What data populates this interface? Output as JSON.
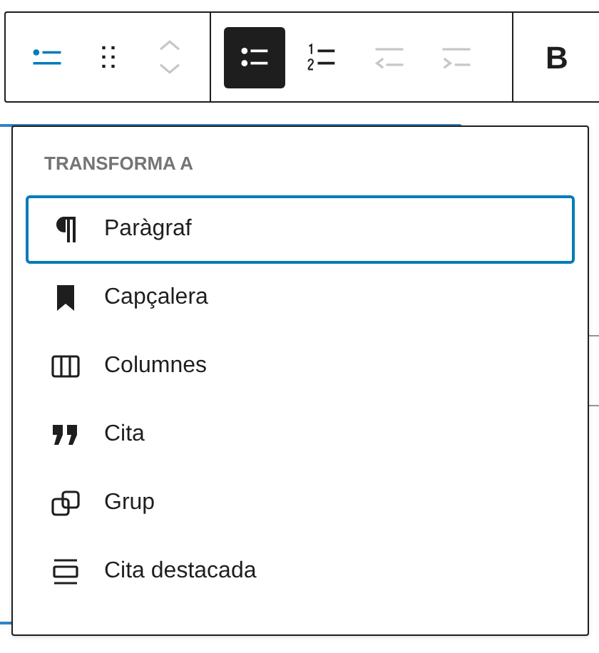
{
  "toolbar": {
    "groups": [
      [
        {
          "kind": "list-block",
          "selected": false,
          "disabled": false
        },
        {
          "kind": "drag",
          "selected": false,
          "disabled": false
        },
        {
          "kind": "move",
          "selected": false,
          "disabled": true
        }
      ],
      [
        {
          "kind": "bullets",
          "selected": true,
          "disabled": false
        },
        {
          "kind": "numbered",
          "selected": false,
          "disabled": false
        },
        {
          "kind": "outdent",
          "selected": false,
          "disabled": true
        },
        {
          "kind": "indent",
          "selected": false,
          "disabled": true
        }
      ],
      [
        {
          "kind": "bold",
          "label": "B",
          "selected": false,
          "disabled": false
        }
      ]
    ]
  },
  "transform_menu": {
    "title": "TRANSFORMA A",
    "items": [
      {
        "kind": "paragraph",
        "label": "Paràgraf",
        "selected": true
      },
      {
        "kind": "heading",
        "label": "Capçalera",
        "selected": false
      },
      {
        "kind": "columns",
        "label": "Columnes",
        "selected": false
      },
      {
        "kind": "quote",
        "label": "Cita",
        "selected": false
      },
      {
        "kind": "group",
        "label": "Grup",
        "selected": false
      },
      {
        "kind": "pullquote",
        "label": "Cita destacada",
        "selected": false
      }
    ]
  }
}
